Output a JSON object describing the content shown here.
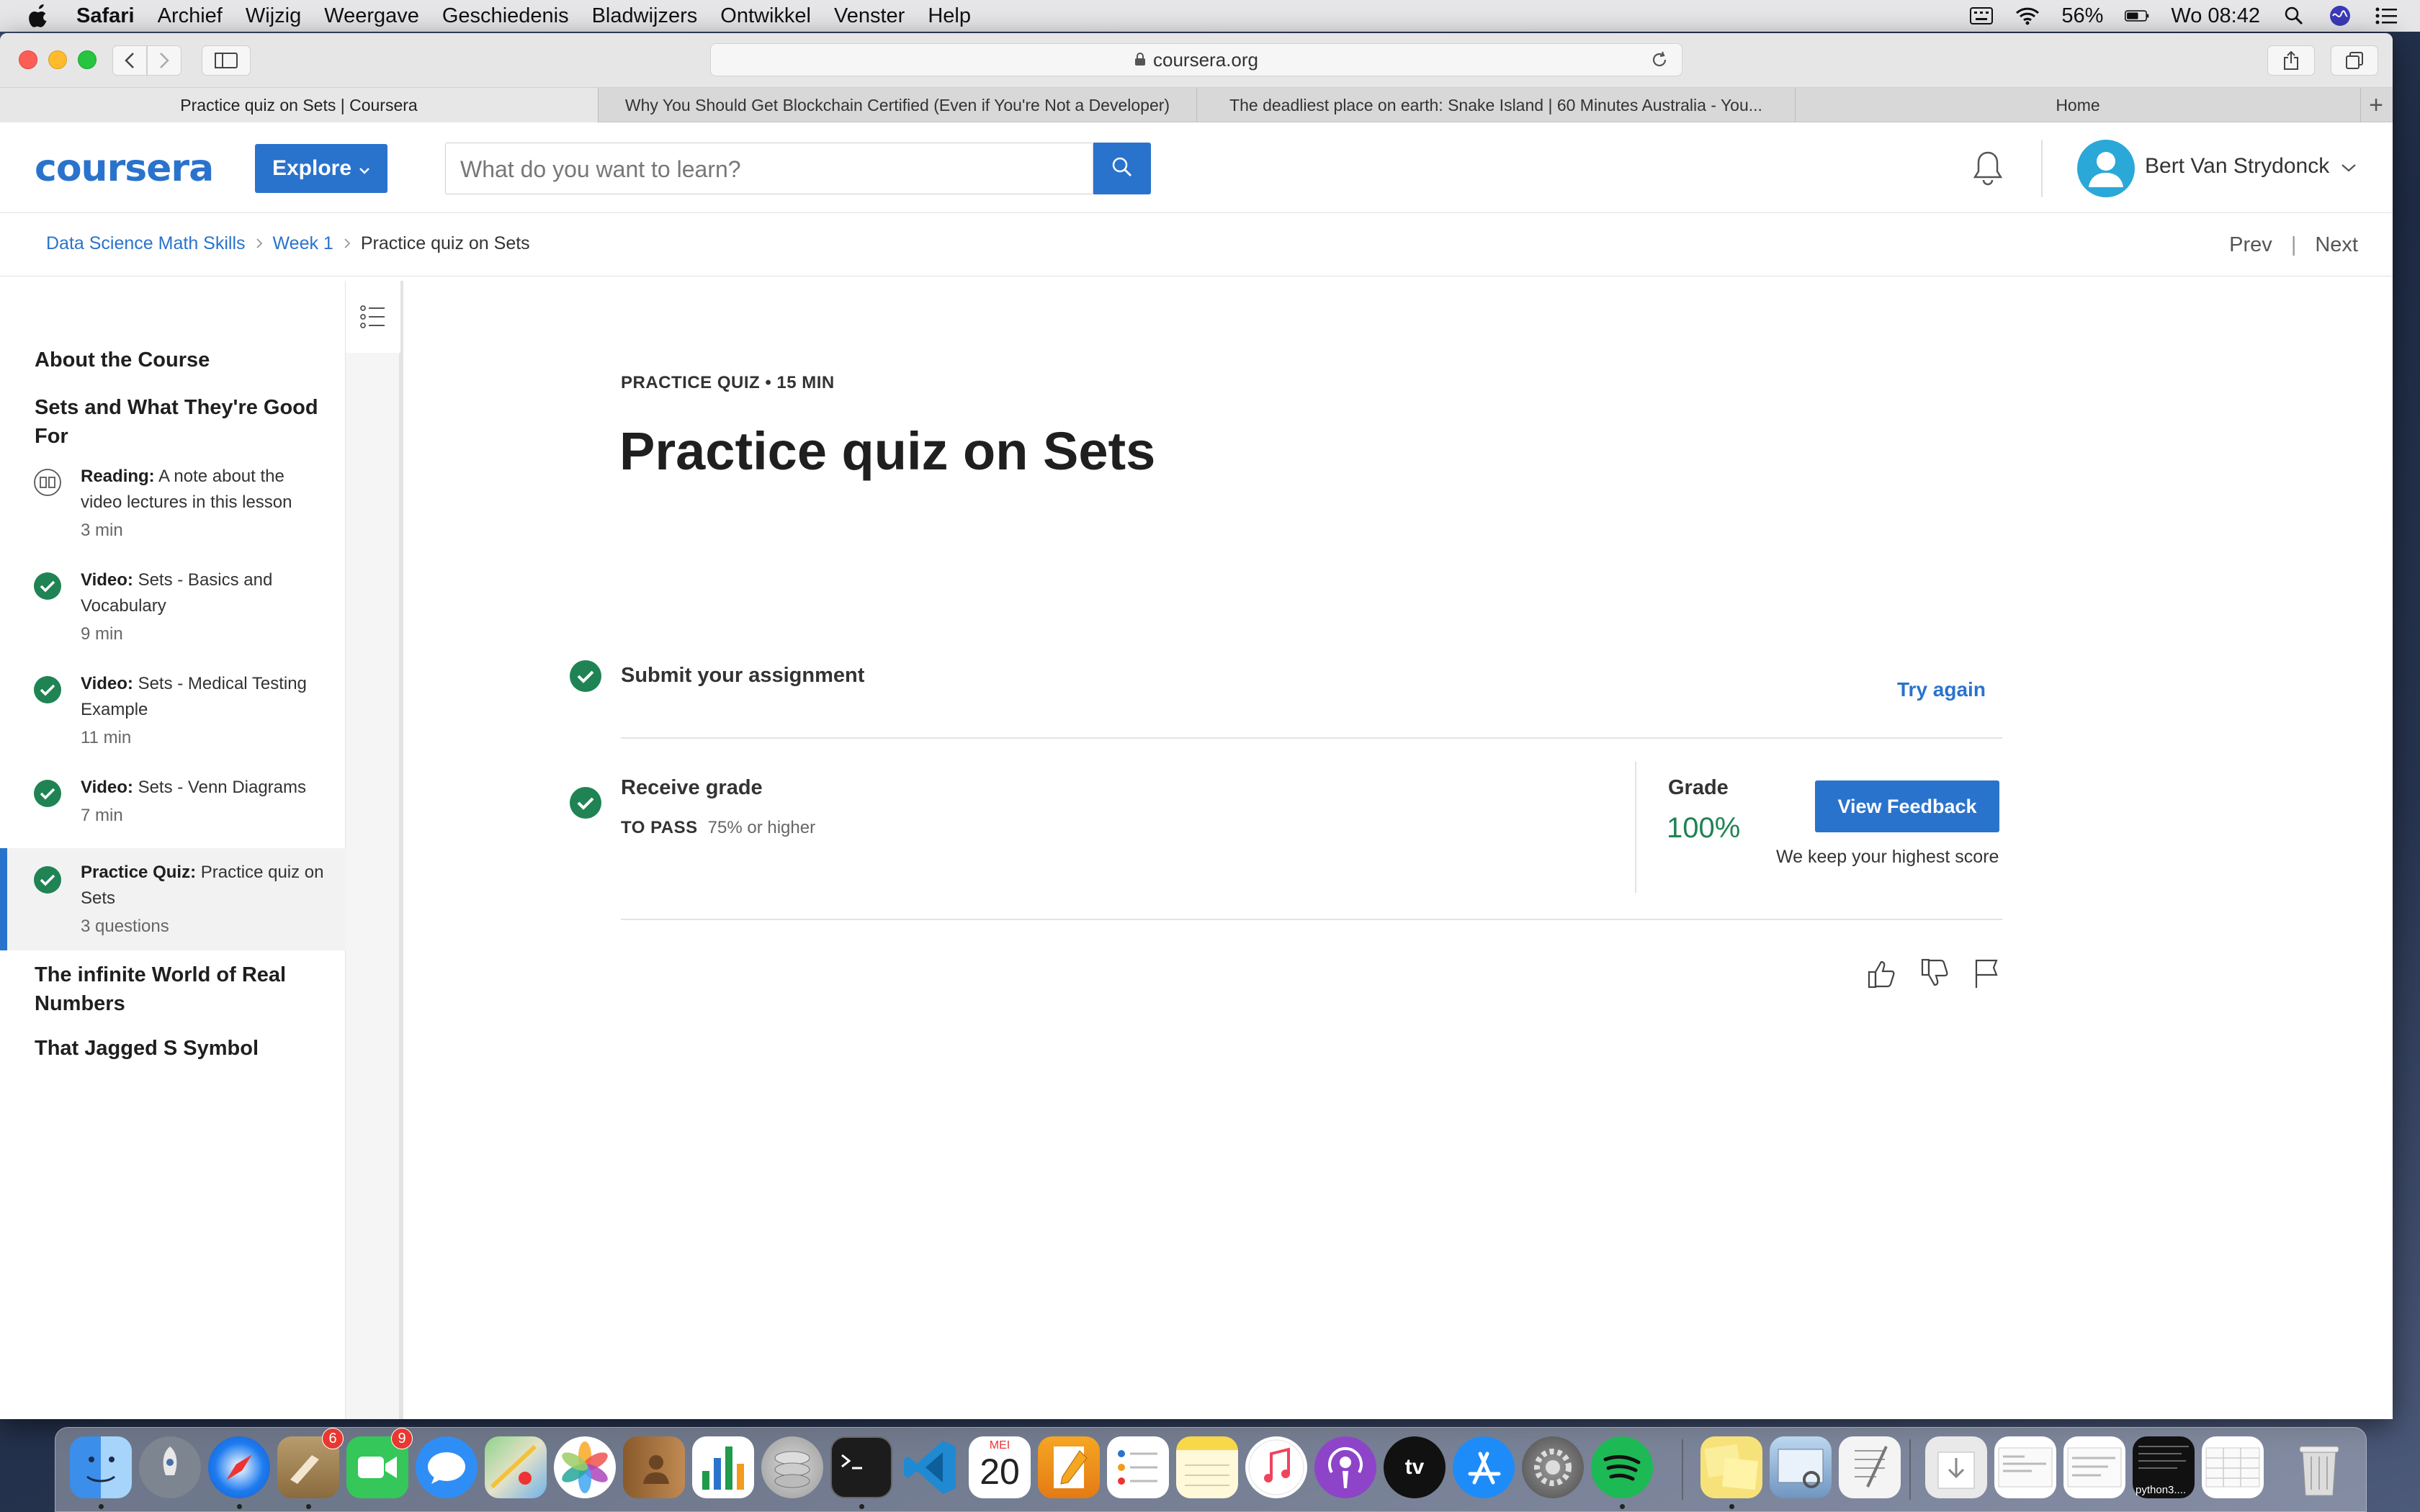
{
  "menubar": {
    "app_name": "Safari",
    "items": [
      "Archief",
      "Wijzig",
      "Weergave",
      "Geschiedenis",
      "Bladwijzers",
      "Ontwikkel",
      "Venster",
      "Help"
    ],
    "battery": "56%",
    "clock": "Wo 08:42"
  },
  "browser": {
    "url": "coursera.org",
    "tabs": [
      {
        "label": "Practice quiz on Sets | Coursera",
        "active": true
      },
      {
        "label": "Why You Should Get Blockchain Certified (Even if You're Not a Developer)",
        "active": false
      },
      {
        "label": "The deadliest place on earth: Snake Island | 60 Minutes Australia - You...",
        "active": false
      },
      {
        "label": "Home",
        "active": false
      }
    ],
    "new_tab": "+"
  },
  "header": {
    "logo": "coursera",
    "explore_label": "Explore",
    "search_placeholder": "What do you want to learn?",
    "user_name": "Bert Van Strydonck"
  },
  "breadcrumb": {
    "course": "Data Science Math Skills",
    "week": "Week 1",
    "current": "Practice quiz on Sets",
    "prev": "Prev",
    "next": "Next",
    "divider": "|"
  },
  "sidebar": {
    "sections": [
      "About the Course",
      "Sets and What They're Good For",
      "The infinite World of Real Numbers",
      "That Jagged S Symbol"
    ],
    "items": [
      {
        "type": "Reading:",
        "title": "A note about the video lectures in this lesson",
        "duration": "3 min",
        "icon": "book-icon",
        "completed": false
      },
      {
        "type": "Video:",
        "title": "Sets - Basics and Vocabulary",
        "duration": "9 min",
        "icon": "check-circle-icon",
        "completed": true
      },
      {
        "type": "Video:",
        "title": "Sets - Medical Testing Example",
        "duration": "11 min",
        "icon": "check-circle-icon",
        "completed": true
      },
      {
        "type": "Video:",
        "title": "Sets - Venn Diagrams",
        "duration": "7 min",
        "icon": "check-circle-icon",
        "completed": true
      },
      {
        "type": "Practice Quiz:",
        "title": "Practice quiz on Sets",
        "duration": "3 questions",
        "icon": "check-circle-icon",
        "completed": true
      }
    ]
  },
  "main": {
    "meta": "PRACTICE QUIZ • 15 MIN",
    "title": "Practice quiz on Sets",
    "submit_label": "Submit your assignment",
    "try_again": "Try again",
    "receive_label": "Receive grade",
    "to_pass_label": "TO PASS",
    "to_pass_value": "75% or higher",
    "grade_label": "Grade",
    "grade_value": "100%",
    "view_feedback": "View Feedback",
    "highest_note": "We keep your highest score"
  },
  "dock": {
    "mail_badge": "6",
    "facetime_badge": "9",
    "calendar_month": "MEI",
    "calendar_day": "20",
    "tv_label": "tv",
    "python_label": "python3...."
  },
  "colors": {
    "brand_blue": "#2a73cc",
    "success_green": "#1f8354",
    "text_dark": "#1f1f1f"
  }
}
